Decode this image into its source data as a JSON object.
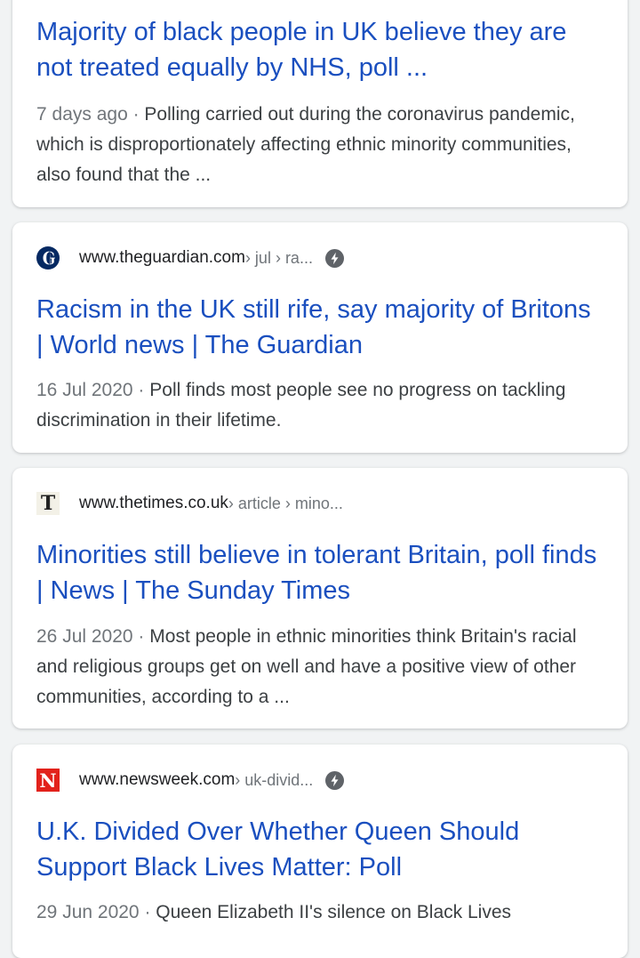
{
  "results": [
    {
      "title": "Majority of black people in UK believe they are not treated equally by NHS, poll ...",
      "date": "7 days ago",
      "separator": " · ",
      "snippet": "Polling carried out during the coronavirus pandemic, which is disproportionately affecting ethnic minority communities, also found that the  ..."
    },
    {
      "site": "www.theguardian.com",
      "path": " › jul › ra...",
      "favicon": "guardian-icon",
      "amp": true,
      "title": "Racism in the UK still rife, say majority of Britons | World news | The Guardian",
      "date": "16 Jul 2020",
      "separator": " · ",
      "snippet": "Poll finds most people see no progress on tackling discrimination in their lifetime."
    },
    {
      "site": "www.thetimes.co.uk",
      "path": " › article › mino...",
      "favicon": "times-icon",
      "favicon_letter": "T",
      "amp": false,
      "title": "Minorities still believe in tolerant Britain, poll finds | News | The Sunday Times",
      "date": "26 Jul 2020",
      "separator": " · ",
      "snippet": "Most people in ethnic minorities think Britain's racial and religious groups get on well and have a positive view of other communities, according to a ..."
    },
    {
      "site": "www.newsweek.com",
      "path": " › uk-divid...",
      "favicon": "newsweek-icon",
      "favicon_letter": "N",
      "amp": true,
      "title": "U.K. Divided Over Whether Queen Should Support Black Lives Matter: Poll",
      "date": "29 Jun 2020",
      "separator": " · ",
      "snippet": "Queen Elizabeth II's silence on Black Lives"
    }
  ],
  "colors": {
    "link": "#1a4fbf",
    "text": "#3c4043",
    "muted": "#70757a",
    "background": "#f1f3f4",
    "card": "#ffffff"
  }
}
